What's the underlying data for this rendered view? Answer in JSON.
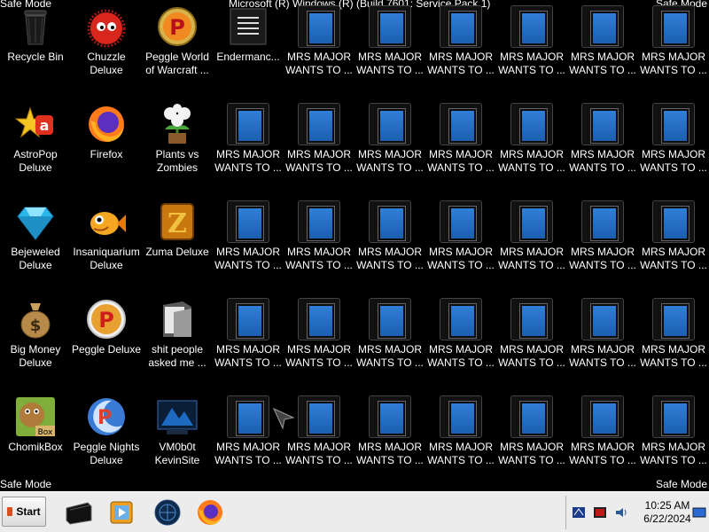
{
  "banner": {
    "safe_mode_tl": "Safe Mode",
    "safe_mode_tr": "Safe Mode",
    "safe_mode_bl": "Safe Mode",
    "safe_mode_br": "Safe Mode",
    "build": "Microsoft (R) Windows (R) (Build 7601: Service Pack 1)"
  },
  "icons": {
    "col1": [
      {
        "label": "Recycle Bin",
        "icon": "recycle-bin-icon"
      },
      {
        "label": "AstroPop\nDeluxe",
        "icon": "astropop-icon"
      },
      {
        "label": "Bejeweled\nDeluxe",
        "icon": "bejeweled-icon"
      },
      {
        "label": "Big Money\nDeluxe",
        "icon": "big-money-icon"
      },
      {
        "label": "ChomikBox",
        "icon": "chomikbox-icon"
      }
    ],
    "col2": [
      {
        "label": "Chuzzle\nDeluxe",
        "icon": "chuzzle-icon"
      },
      {
        "label": "Firefox",
        "icon": "firefox-icon"
      },
      {
        "label": "Insaniquarium\nDeluxe",
        "icon": "insaniquarium-icon"
      },
      {
        "label": "Peggle Deluxe",
        "icon": "peggle-icon"
      },
      {
        "label": "Peggle Nights\nDeluxe",
        "icon": "peggle-nights-icon"
      }
    ],
    "col3": [
      {
        "label": "Peggle World\nof Warcraft ...",
        "icon": "peggle-wow-icon"
      },
      {
        "label": "Plants vs\nZombies",
        "icon": "plants-vs-zombies-icon"
      },
      {
        "label": "Zuma Deluxe",
        "icon": "zuma-icon"
      },
      {
        "label": "shit people\nasked me ...",
        "icon": "folder-icon"
      },
      {
        "label": "VM0b0t\nKevinSite",
        "icon": "vm0b0t-icon"
      }
    ],
    "col4_first": {
      "label": "Endermanc...",
      "icon": "document-icon"
    },
    "mrs_major_label": "MRS MAJOR\nWANTS TO ..."
  },
  "taskbar": {
    "start_label": "Start",
    "apps": [
      "explorer-icon",
      "media-player-icon",
      "network-globe-icon",
      "firefox-icon"
    ],
    "clock_time": "10:25 AM",
    "clock_date": "6/22/2024"
  },
  "colors": {
    "desktop_bg": "#000000",
    "taskbar_bg": "#ececec",
    "exe_blue": "#2f7fd6"
  }
}
